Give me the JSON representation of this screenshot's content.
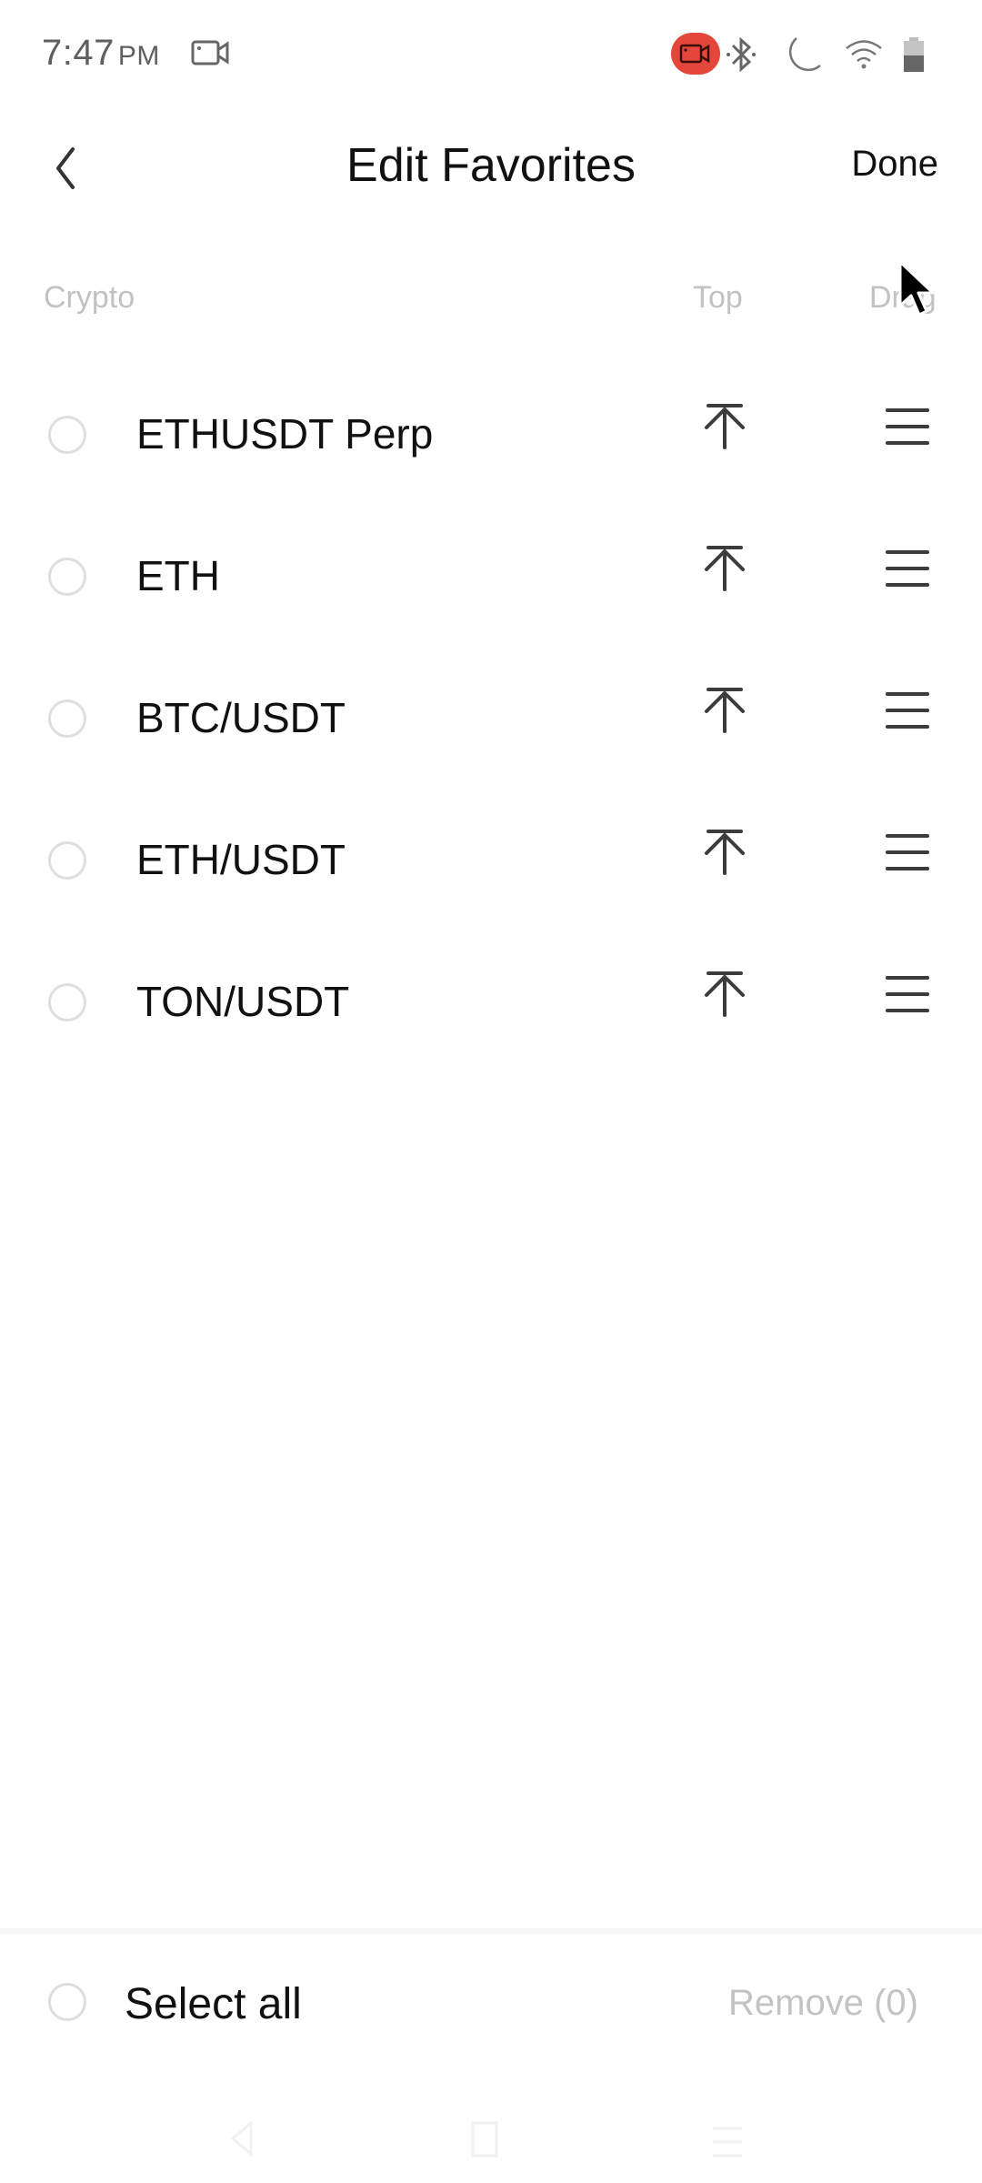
{
  "status_bar": {
    "time": "7:47",
    "ampm": "PM",
    "icons": [
      "screen-record-icon",
      "recording-active-icon",
      "bluetooth-icon",
      "do-not-disturb-moon-icon",
      "wifi-icon",
      "battery-icon"
    ],
    "colors": {
      "recording": "#e5463b",
      "icon": "#666666"
    }
  },
  "header": {
    "back_icon": "chevron-left-icon",
    "title": "Edit Favorites",
    "done_label": "Done"
  },
  "columns": {
    "crypto": "Crypto",
    "top": "Top",
    "drag": "Drag"
  },
  "favorites": [
    {
      "name": "ETHUSDT Perp",
      "selected": false
    },
    {
      "name": "ETH",
      "selected": false
    },
    {
      "name": "BTC/USDT",
      "selected": false
    },
    {
      "name": "ETH/USDT",
      "selected": false
    },
    {
      "name": "TON/USDT",
      "selected": false
    }
  ],
  "row_icons": {
    "top": "move-to-top-icon",
    "drag": "drag-handle-icon"
  },
  "bottom_bar": {
    "select_all_label": "Select all",
    "select_all_checked": false,
    "remove_label": "Remove (0)",
    "remove_count": 0
  },
  "nav_bar": {
    "buttons": [
      "back-triangle-icon",
      "home-square-icon",
      "recents-menu-icon"
    ]
  },
  "colors": {
    "text_primary": "#111111",
    "text_muted": "#c2c2c2",
    "radio_border": "#dedede",
    "icon": "#3c3c3c"
  }
}
